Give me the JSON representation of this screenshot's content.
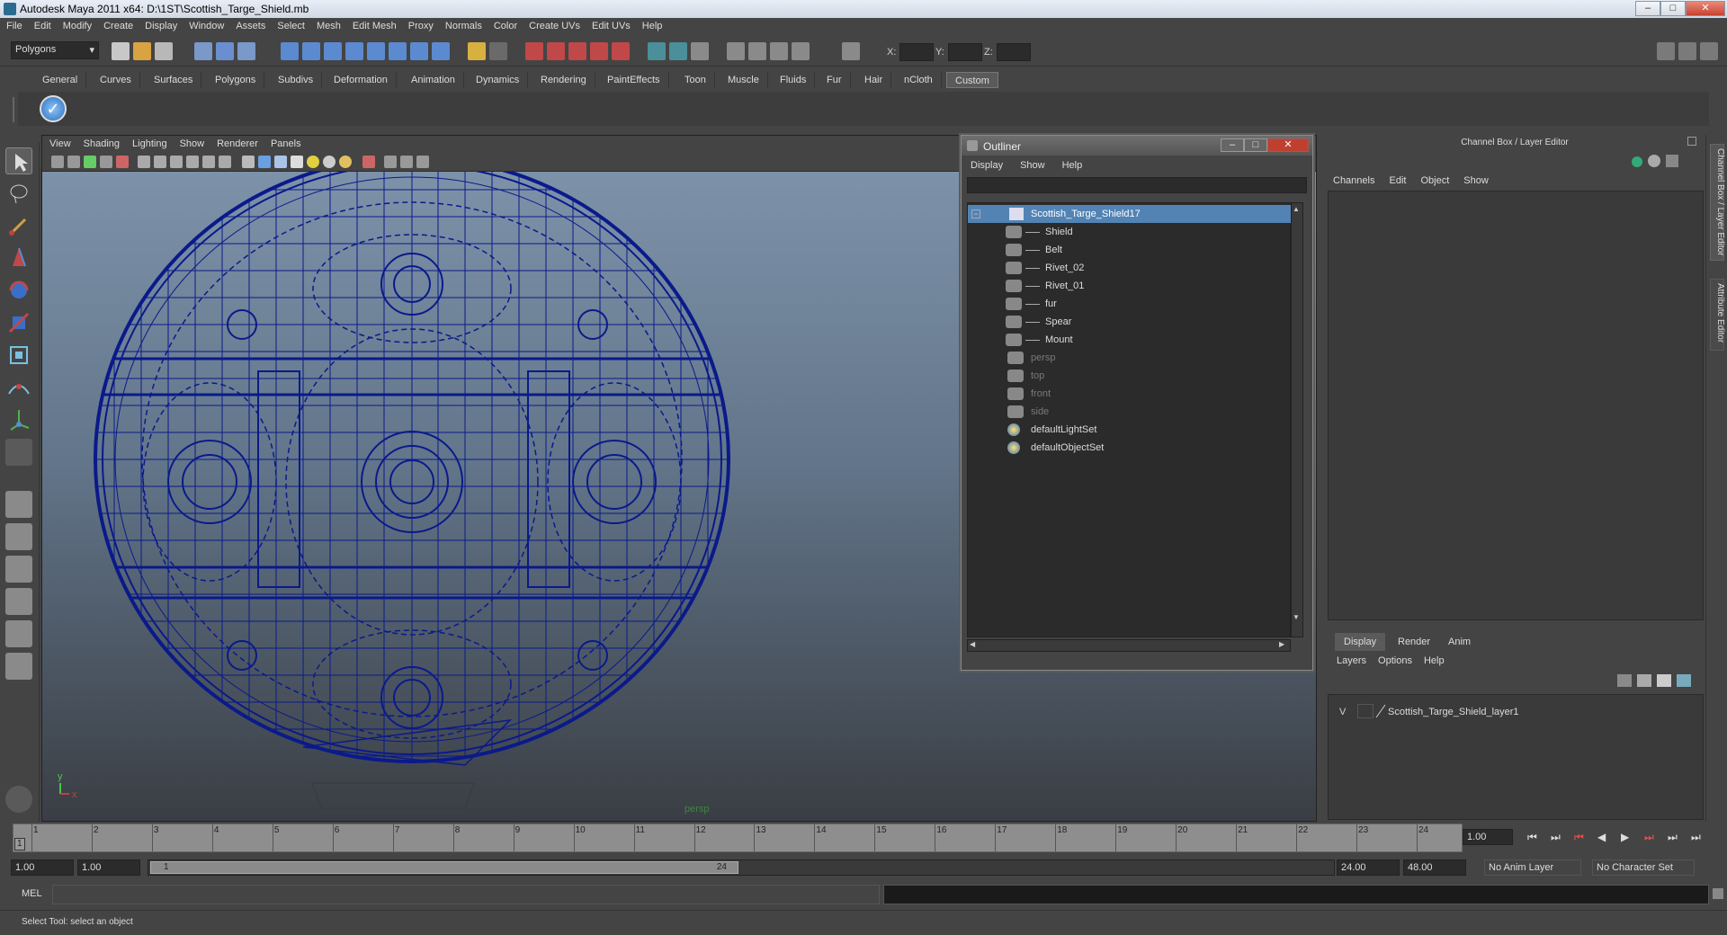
{
  "window": {
    "title": "Autodesk Maya 2011 x64: D:\\1ST\\Scottish_Targe_Shield.mb",
    "buttons": [
      "‒",
      "□",
      "✕"
    ]
  },
  "menubar": [
    "File",
    "Edit",
    "Modify",
    "Create",
    "Display",
    "Window",
    "Assets",
    "Select",
    "Mesh",
    "Edit Mesh",
    "Proxy",
    "Normals",
    "Color",
    "Create UVs",
    "Edit UVs",
    "Help"
  ],
  "statusline": {
    "mode": "Polygons",
    "x_label": "X:",
    "y_label": "Y:",
    "z_label": "Z:"
  },
  "shelf": {
    "tabs": [
      "General",
      "Curves",
      "Surfaces",
      "Polygons",
      "Subdivs",
      "Deformation",
      "Animation",
      "Dynamics",
      "Rendering",
      "PaintEffects",
      "Toon",
      "Muscle",
      "Fluids",
      "Fur",
      "Hair",
      "nCloth",
      "Custom"
    ],
    "active": "Custom"
  },
  "viewport": {
    "menu": [
      "View",
      "Shading",
      "Lighting",
      "Show",
      "Renderer",
      "Panels"
    ],
    "camera_label": "persp",
    "axis_y": "y",
    "axis_x": "x"
  },
  "outliner": {
    "title": "Outliner",
    "menu": [
      "Display",
      "Show",
      "Help"
    ],
    "items": [
      {
        "name": "Scottish_Targe_Shield17",
        "level": 0,
        "selected": true,
        "dim": false,
        "icon": "group-icon"
      },
      {
        "name": "Shield",
        "level": 1,
        "selected": false,
        "dim": false,
        "icon": "mesh-icon"
      },
      {
        "name": "Belt",
        "level": 1,
        "selected": false,
        "dim": false,
        "icon": "mesh-icon"
      },
      {
        "name": "Rivet_02",
        "level": 1,
        "selected": false,
        "dim": false,
        "icon": "mesh-icon"
      },
      {
        "name": "Rivet_01",
        "level": 1,
        "selected": false,
        "dim": false,
        "icon": "mesh-icon"
      },
      {
        "name": "fur",
        "level": 1,
        "selected": false,
        "dim": false,
        "icon": "mesh-icon"
      },
      {
        "name": "Spear",
        "level": 1,
        "selected": false,
        "dim": false,
        "icon": "mesh-icon"
      },
      {
        "name": "Mount",
        "level": 1,
        "selected": false,
        "dim": false,
        "icon": "mesh-icon"
      },
      {
        "name": "persp",
        "level": 0,
        "selected": false,
        "dim": true,
        "icon": "camera-icon"
      },
      {
        "name": "top",
        "level": 0,
        "selected": false,
        "dim": true,
        "icon": "camera-icon"
      },
      {
        "name": "front",
        "level": 0,
        "selected": false,
        "dim": true,
        "icon": "camera-icon"
      },
      {
        "name": "side",
        "level": 0,
        "selected": false,
        "dim": true,
        "icon": "camera-icon"
      },
      {
        "name": "defaultLightSet",
        "level": 0,
        "selected": false,
        "dim": false,
        "icon": "set-icon"
      },
      {
        "name": "defaultObjectSet",
        "level": 0,
        "selected": false,
        "dim": false,
        "icon": "set-icon"
      }
    ]
  },
  "channelbox": {
    "title": "Channel Box / Layer Editor",
    "menu": [
      "Channels",
      "Edit",
      "Object",
      "Show"
    ],
    "layer_tabs": [
      "Display",
      "Render",
      "Anim"
    ],
    "layer_active": "Display",
    "layer_menu": [
      "Layers",
      "Options",
      "Help"
    ],
    "layer": {
      "visible": "V",
      "name": "Scottish_Targe_Shield_layer1"
    },
    "side_tabs": [
      "Channel Box / Layer Editor",
      "Attribute Editor"
    ]
  },
  "timeslider": {
    "ticks": [
      "1",
      "2",
      "3",
      "4",
      "5",
      "6",
      "7",
      "8",
      "9",
      "10",
      "11",
      "12",
      "13",
      "14",
      "15",
      "16",
      "17",
      "18",
      "19",
      "20",
      "21",
      "22",
      "23",
      "24"
    ],
    "current_frame": "1.00",
    "start_marker": "1"
  },
  "rangeslider": {
    "start": "1.00",
    "playback_start": "1.00",
    "range_start_label": "1",
    "range_end_label": "24",
    "playback_end": "24.00",
    "end": "48.00",
    "anim_layer": "No Anim Layer",
    "character_set": "No Character Set"
  },
  "cmdline": {
    "label": "MEL"
  },
  "helpline": {
    "text": "Select Tool: select an object"
  },
  "colors": {
    "ui_bg": "#444444",
    "field_bg": "#2b2b2b",
    "selection": "#5283b4",
    "wireframe": "#0a1a8a"
  }
}
